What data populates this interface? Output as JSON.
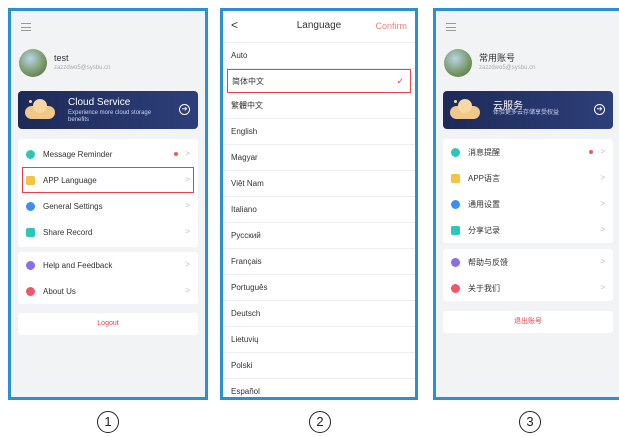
{
  "screen1": {
    "user": {
      "name": "test",
      "email": "zazzdwo5@sysbu.cn"
    },
    "banner": {
      "title": "Cloud Service",
      "subtitle": "Experience more cloud storage benefits"
    },
    "group1": [
      {
        "label": "Message Reminder",
        "icon": "bell-icon",
        "color": "#2ec7b5",
        "badge": true
      },
      {
        "label": "APP Language",
        "icon": "language-icon",
        "color": "#f5c342",
        "highlighted": true
      },
      {
        "label": "General Settings",
        "icon": "settings-icon",
        "color": "#3c8ff0"
      },
      {
        "label": "Share Record",
        "icon": "share-icon",
        "color": "#2ec7b5"
      }
    ],
    "group2": [
      {
        "label": "Help and Feedback",
        "icon": "help-icon",
        "color": "#8a6ee8"
      },
      {
        "label": "About Us",
        "icon": "info-icon",
        "color": "#f0556a"
      }
    ],
    "logout": "Logout"
  },
  "screen2": {
    "back": "<",
    "title": "Language",
    "confirm": "Confirm",
    "languages": [
      "Auto",
      "简体中文",
      "繁體中文",
      "English",
      "Magyar",
      "Việt Nam",
      "Italiano",
      "Русский",
      "Français",
      "Português",
      "Deutsch",
      "Lietuvių",
      "Polski",
      "Español"
    ],
    "selected_index": 1
  },
  "screen3": {
    "user": {
      "name": "常用账号",
      "email": "zazzdwo5@sysbu.cn"
    },
    "banner": {
      "title": "云服务",
      "subtitle": "体验更多云存储享受权益"
    },
    "group1": [
      {
        "label": "消息提醒",
        "icon": "bell-icon",
        "color": "#2ec7b5",
        "badge": true
      },
      {
        "label": "APP语言",
        "icon": "language-icon",
        "color": "#f5c342"
      },
      {
        "label": "通用设置",
        "icon": "settings-icon",
        "color": "#3c8ff0"
      },
      {
        "label": "分享记录",
        "icon": "share-icon",
        "color": "#2ec7b5"
      }
    ],
    "group2": [
      {
        "label": "帮助与反馈",
        "icon": "help-icon",
        "color": "#8a6ee8"
      },
      {
        "label": "关于我们",
        "icon": "info-icon",
        "color": "#f0556a"
      }
    ],
    "logout": "退出账号"
  },
  "captions": [
    "1",
    "2",
    "3"
  ],
  "chevron": ">"
}
